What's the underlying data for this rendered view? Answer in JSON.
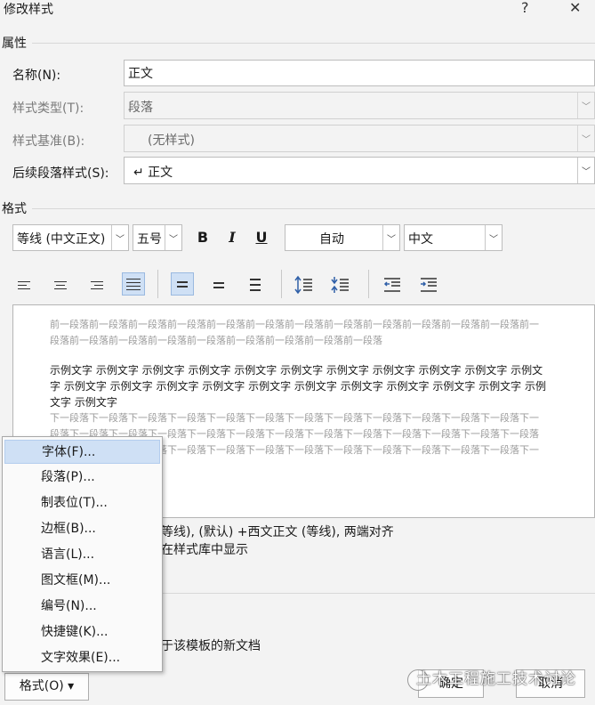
{
  "window": {
    "title": "修改样式",
    "help_label": "?",
    "close_label": "✕"
  },
  "properties": {
    "section_label": "属性",
    "name": {
      "label": "名称(N):",
      "value": "正文"
    },
    "style_type": {
      "label": "样式类型(T):",
      "value": "段落"
    },
    "style_based_on": {
      "label": "样式基准(B):",
      "value": "(无样式)"
    },
    "next_style": {
      "label": "后续段落样式(S):",
      "value": "↵ 正文"
    }
  },
  "format": {
    "section_label": "格式",
    "font": "等线 (中文正文)",
    "size": "五号",
    "bold_label": "B",
    "italic_label": "I",
    "underline_label": "U",
    "color": "自动",
    "script": "中文"
  },
  "preview": {
    "prev_para": "前一段落前一段落前一段落前一段落前一段落前一段落前一段落前一段落前一段落前一段落前一段落前一段落前一段落前一段落前一段落前一段落前一段落前一段落前一段落前一段落前一段落",
    "sample": "示例文字 示例文字 示例文字 示例文字 示例文字 示例文字 示例文字 示例文字 示例文字 示例文字 示例文字 示例文字 示例文字 示例文字 示例文字 示例文字 示例文字 示例文字 示例文字 示例文字 示例文字 示例文字 示例文字",
    "next_para": "下一段落下一段落下一段落下一段落下一段落下一段落下一段落下一段落下一段落下一段落下一段落下一段落下一段落下一段落下一段落下一段落下一段落下一段落下一段落下一段落下一段落下一段落下一段落下一段落下一段落下一段落下一段落下一段落下一段落下一段落下一段落下一段落下一段落下一段落下一段落下一段落下一段落下一段落下一段落"
  },
  "description": {
    "line1": "等线), (默认) +西文正文 (等线), 两端对齐",
    "line2": "在样式库中显示",
    "line3": "于该模板的新文档"
  },
  "menu": {
    "items": [
      {
        "label": "字体(F)..."
      },
      {
        "label": "段落(P)..."
      },
      {
        "label": "制表位(T)..."
      },
      {
        "label": "边框(B)..."
      },
      {
        "label": "语言(L)..."
      },
      {
        "label": "图文框(M)..."
      },
      {
        "label": "编号(N)..."
      },
      {
        "label": "快捷键(K)..."
      },
      {
        "label": "文字效果(E)..."
      }
    ]
  },
  "buttons": {
    "format": "格式(O) ▾",
    "ok": "确定",
    "cancel": "取消"
  },
  "watermark": "土木工程施工技术讨论"
}
